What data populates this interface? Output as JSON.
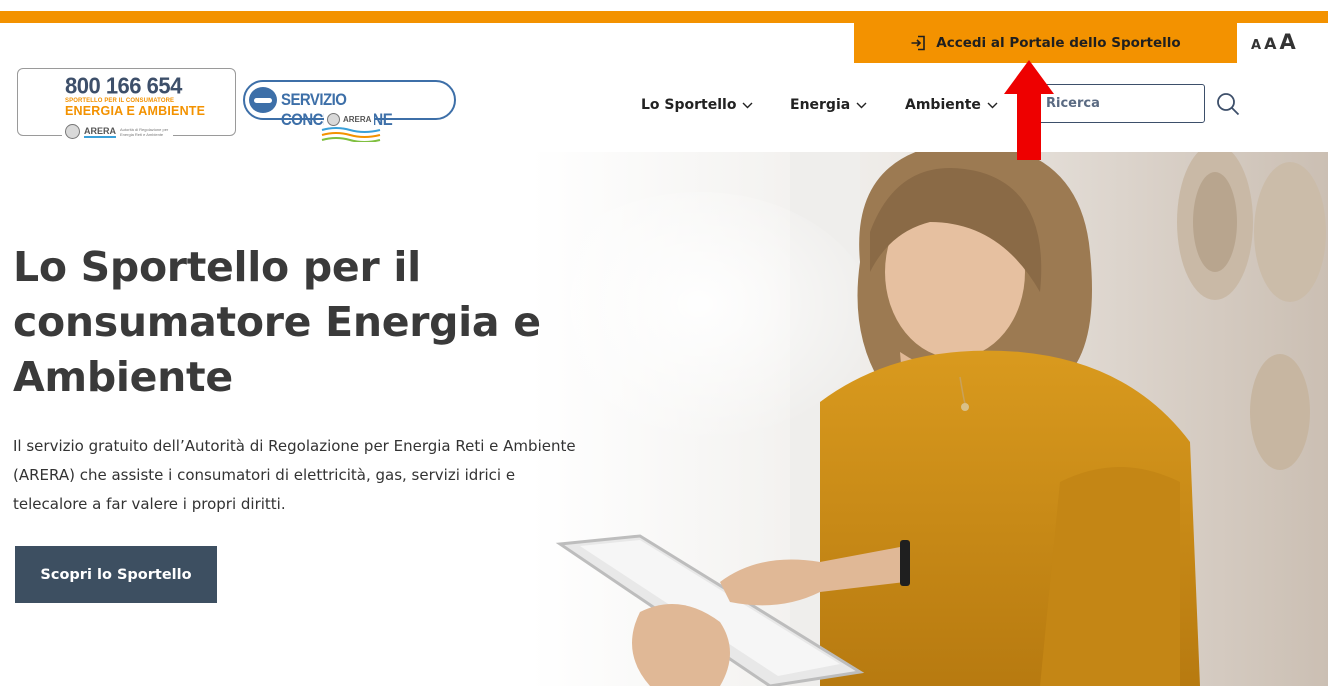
{
  "header": {
    "portal_button": "Accedi al Portale dello Sportello",
    "font_size_controls": [
      "A",
      "A",
      "A"
    ],
    "accent_color": "#f39200",
    "dark_color": "#3d4f61"
  },
  "logos": {
    "phone": {
      "number": "800 166 654",
      "line1": "SPORTELLO PER IL CONSUMATORE",
      "line2": "ENERGIA E AMBIENTE",
      "arera": "ARERA",
      "arera_small": "Autorità di Regolazione per Energia Reti e Ambiente"
    },
    "conciliazione": {
      "title": "SERVIZIO CONCILIAZIONE",
      "arera": "ARERA"
    }
  },
  "nav": {
    "items": [
      {
        "label": "Lo Sportello"
      },
      {
        "label": "Energia"
      },
      {
        "label": "Ambiente"
      }
    ],
    "search_placeholder": "Ricerca"
  },
  "hero": {
    "title": "Lo Sportello per il consumatore Energia e Ambiente",
    "description": "Il servizio gratuito dell’Autorità di Regolazione per Energia Reti e Ambiente (ARERA) che assiste i consumatori di elettricità, gas, servizi idrici e telecalore a far valere i propri diritti.",
    "cta": "Scopri lo Sportello"
  }
}
